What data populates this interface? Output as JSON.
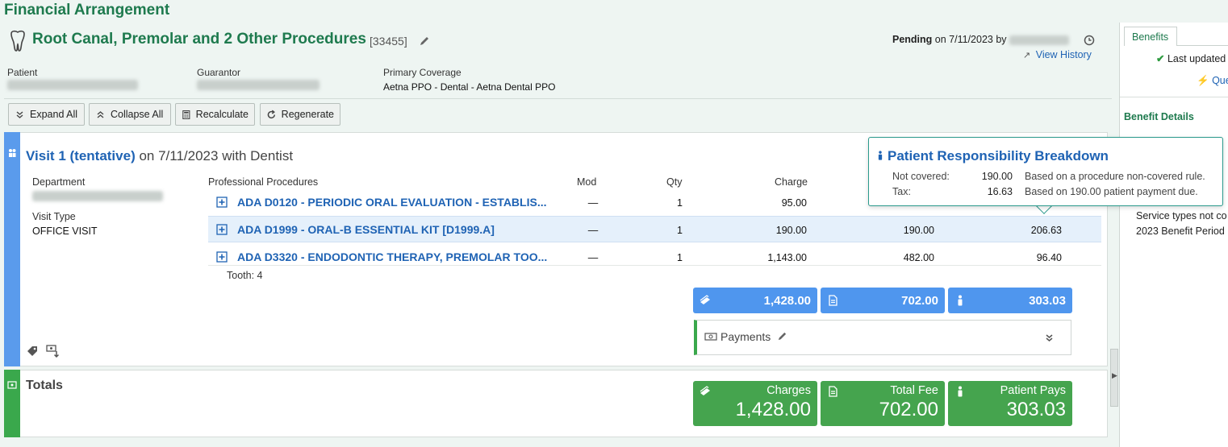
{
  "app": {
    "title": "Financial Arrangement"
  },
  "header": {
    "procedure_title": "Root Canal, Premolar and 2 Other Procedures",
    "procedure_id": "[33455]",
    "status_label": "Pending",
    "status_on": "on 7/11/2023 by",
    "view_history": "View History",
    "patient_label": "Patient",
    "guarantor_label": "Guarantor",
    "coverage_label": "Primary Coverage",
    "coverage_value": "Aetna PPO - Dental - Aetna Dental PPO"
  },
  "toolbar": {
    "expand_all": "Expand All",
    "collapse_all": "Collapse All",
    "recalculate": "Recalculate",
    "regenerate": "Regenerate"
  },
  "visit": {
    "title_link": "Visit 1 (tentative)",
    "title_rest": "on 7/11/2023 with Dentist",
    "department_label": "Department",
    "visit_type_label": "Visit Type",
    "visit_type_value": "OFFICE VISIT",
    "columns": {
      "procedures": "Professional Procedures",
      "mod": "Mod",
      "qty": "Qty",
      "charge": "Charge"
    },
    "rows": [
      {
        "name": "ADA D0120 - PERIODIC ORAL EVALUATION - ESTABLIS...",
        "mod": "—",
        "qty": "1",
        "charge": "95.00",
        "fee": "",
        "pays": ""
      },
      {
        "name": "ADA D1999 - ORAL-B ESSENTIAL KIT [D1999.A]",
        "mod": "—",
        "qty": "1",
        "charge": "190.00",
        "fee": "190.00",
        "pays": "206.63"
      },
      {
        "name": "ADA D3320 - ENDODONTIC THERAPY, PREMOLAR TOO...",
        "mod": "—",
        "qty": "1",
        "charge": "1,143.00",
        "fee": "482.00",
        "pays": "96.40"
      }
    ],
    "tooth_label": "Tooth: 4",
    "summary": {
      "charges": "1,428.00",
      "fee": "702.00",
      "pays": "303.03"
    },
    "payments_label": "Payments"
  },
  "popover": {
    "title": "Patient Responsibility Breakdown",
    "rows": [
      {
        "label": "Not covered:",
        "value": "190.00",
        "note": "Based on a procedure non-covered rule."
      },
      {
        "label": "Tax:",
        "value": "16.63",
        "note": "Based on 190.00 patient payment due."
      }
    ]
  },
  "totals": {
    "title": "Totals",
    "charges_label": "Charges",
    "charges_value": "1,428.00",
    "fee_label": "Total Fee",
    "fee_value": "702.00",
    "pays_label": "Patient Pays",
    "pays_value": "303.03"
  },
  "right_panel": {
    "tab": "Benefits",
    "last_updated": "Last updated",
    "query": "Que",
    "benefit_details": "Benefit Details",
    "line1": "Service types not co",
    "line2": "2023 Benefit Period"
  },
  "colors": {
    "brand_green": "#1e7a4e",
    "link_blue": "#1f63b4",
    "tile_blue": "#4f96ee",
    "tile_green": "#45a44e",
    "popover_border": "#2b9a8c"
  }
}
